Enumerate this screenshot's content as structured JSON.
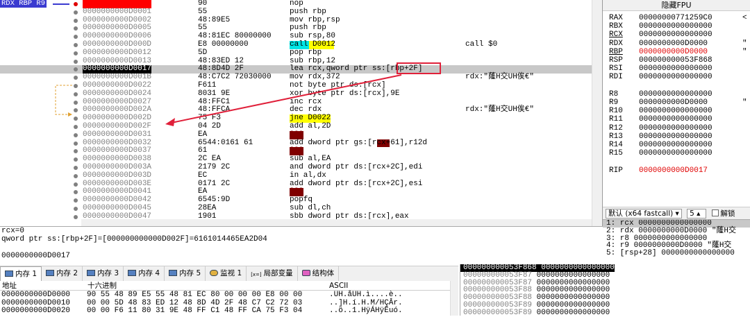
{
  "gutter_tags": [
    {
      "name": "tag-rdx-rbp-r9",
      "text": "RDX RBP R9"
    },
    {
      "name": "tag-rip",
      "text": "RIP"
    }
  ],
  "disasm": [
    {
      "addr": "0000000000D0000",
      "hex": "90",
      "ins": "nop",
      "cmt": "",
      "dot": "red",
      "addr_style": "hl"
    },
    {
      "addr": "0000000000D0001",
      "hex": "55",
      "ins": "push rbp",
      "cmt": ""
    },
    {
      "addr": "0000000000D0002",
      "hex": "48:89E5",
      "ins": "mov rbp,rsp",
      "cmt": ""
    },
    {
      "addr": "0000000000D0005",
      "hex": "55",
      "ins": "push rbp",
      "cmt": ""
    },
    {
      "addr": "0000000000D0006",
      "hex": "48:81EC 80000000",
      "ins": "sub rsp,80",
      "cmt": ""
    },
    {
      "addr": "0000000000D000D",
      "hex": "E8 00000000",
      "ins": "call D0012",
      "cmt": "call $0",
      "ins_style": "call"
    },
    {
      "addr": "0000000000D0012",
      "hex": "5D",
      "ins": "pop rbp",
      "cmt": ""
    },
    {
      "addr": "0000000000D0013",
      "hex": "48:83ED 12",
      "ins": "sub rbp,12",
      "cmt": ""
    },
    {
      "addr": "0000000000D0017",
      "hex": "48:8D4D 2F",
      "ins": "lea rcx,qword ptr ss:[rbp+2F]",
      "cmt": "",
      "addr_style": "rip",
      "sel": true
    },
    {
      "addr": "0000000000D001B",
      "hex": "48:C7C2 72030000",
      "ins": "mov rdx,372",
      "cmt": "rdx:\"蕯H交UH俟€\""
    },
    {
      "addr": "0000000000D0022",
      "hex": "F611",
      "ins": "not byte ptr ds:[rcx]",
      "cmt": ""
    },
    {
      "addr": "0000000000D0024",
      "hex": "8031 9E",
      "ins": "xor byte ptr ds:[rcx],9E",
      "cmt": ""
    },
    {
      "addr": "0000000000D0027",
      "hex": "48:FFC1",
      "ins": "inc rcx",
      "cmt": ""
    },
    {
      "addr": "0000000000D002A",
      "hex": "48:FFCA",
      "ins": "dec rdx",
      "cmt": "rdx:\"蕯H交UH俟€\""
    },
    {
      "addr": "0000000000D002D",
      "hex": "75 F3",
      "ins": "jne D0022",
      "cmt": "",
      "ins_style": "jne"
    },
    {
      "addr": "0000000000D002F",
      "hex": "04 2D",
      "ins": "add al,2D",
      "cmt": ""
    },
    {
      "addr": "0000000000D0031",
      "hex": "EA",
      "ins": "???",
      "cmt": "",
      "ins_style": "bad"
    },
    {
      "addr": "0000000000D0032",
      "hex": "6544:0161 61",
      "ins": "add dword ptr gs:[rcx+61],r12d",
      "cmt": "",
      "ins_style": "seg"
    },
    {
      "addr": "0000000000D0037",
      "hex": "61",
      "ins": "???",
      "cmt": "",
      "ins_style": "bad"
    },
    {
      "addr": "0000000000D0038",
      "hex": "2C EA",
      "ins": "sub al,EA",
      "cmt": ""
    },
    {
      "addr": "0000000000D003A",
      "hex": "2179 2C",
      "ins": "and dword ptr ds:[rcx+2C],edi",
      "cmt": ""
    },
    {
      "addr": "0000000000D003D",
      "hex": "EC",
      "ins": "in al,dx",
      "cmt": ""
    },
    {
      "addr": "0000000000D003E",
      "hex": "0171 2C",
      "ins": "add dword ptr ds:[rcx+2C],esi",
      "cmt": ""
    },
    {
      "addr": "0000000000D0041",
      "hex": "EA",
      "ins": "???",
      "cmt": "",
      "ins_style": "bad"
    },
    {
      "addr": "0000000000D0042",
      "hex": "6545:9D",
      "ins": "popfq",
      "cmt": ""
    },
    {
      "addr": "0000000000D0045",
      "hex": "28EA",
      "ins": "sub dl,ch",
      "cmt": ""
    },
    {
      "addr": "0000000000D0047",
      "hex": "1901",
      "ins": "sbb dword ptr ds:[rcx],eax",
      "cmt": ""
    }
  ],
  "fpu_header": "隐藏FPU",
  "registers": [
    {
      "n": "RAX",
      "v": "00000000771259C0",
      "extra": "<"
    },
    {
      "n": "RBX",
      "v": "0000000000000000",
      "extra": ""
    },
    {
      "n": "RCX",
      "v": "0000000000000000",
      "extra": ""
    },
    {
      "n": "RDX",
      "v": "0000000000D0000",
      "extra": "\""
    },
    {
      "n": "RBP",
      "v": "0000000000D0000",
      "extra": "\"",
      "changed": true
    },
    {
      "n": "RSP",
      "v": "000000000053F868",
      "extra": ""
    },
    {
      "n": "RSI",
      "v": "0000000000000000",
      "extra": ""
    },
    {
      "n": "RDI",
      "v": "0000000000000000",
      "extra": ""
    },
    {
      "n": "",
      "v": "",
      "extra": ""
    },
    {
      "n": "R8",
      "v": "0000000000000000",
      "extra": ""
    },
    {
      "n": "R9",
      "v": "0000000000D0000",
      "extra": "\""
    },
    {
      "n": "R10",
      "v": "0000000000000000",
      "extra": ""
    },
    {
      "n": "R11",
      "v": "0000000000000000",
      "extra": ""
    },
    {
      "n": "R12",
      "v": "0000000000000000",
      "extra": ""
    },
    {
      "n": "R13",
      "v": "0000000000000000",
      "extra": ""
    },
    {
      "n": "R14",
      "v": "0000000000000000",
      "extra": ""
    },
    {
      "n": "R15",
      "v": "0000000000000000",
      "extra": ""
    },
    {
      "n": "",
      "v": "",
      "extra": ""
    },
    {
      "n": "RIP",
      "v": "0000000000D0017",
      "extra": "",
      "changed": true
    }
  ],
  "callconv": {
    "select": "默认 (x64 fastcall)",
    "spin": "5",
    "unlock": "解锁"
  },
  "stack_args": [
    "1: rcx 0000000000000000",
    "2: rdx 0000000000D0000 \"蕯H交",
    "3: r8 0000000000000000",
    "4: r9 0000000000D0000 \"蕯H交",
    "5: [rsp+28] 0000000000000000"
  ],
  "info_lines": [
    "rcx=0",
    "qword ptr ss:[rbp+2F]=[000000000000D002F]=6161014465EA2D04",
    "",
    "0000000000D0017"
  ],
  "tabs": [
    {
      "label": "内存 1",
      "icon": "memory-icon",
      "active": true
    },
    {
      "label": "内存 2",
      "icon": "memory-icon"
    },
    {
      "label": "内存 3",
      "icon": "memory-icon"
    },
    {
      "label": "内存 4",
      "icon": "memory-icon"
    },
    {
      "label": "内存 5",
      "icon": "memory-icon"
    },
    {
      "label": "监视 1",
      "icon": "watch-icon"
    },
    {
      "label": "局部变量",
      "icon": "locals-icon",
      "prefix": "[x=]"
    },
    {
      "label": "结构体",
      "icon": "struct-icon"
    }
  ],
  "dump_header": {
    "addr": "地址",
    "hex": "十六进制",
    "ascii": "ASCII"
  },
  "dump_rows": [
    {
      "a": "0000000000D0000",
      "h": "90 55 48 89 E5 55 48 81 EC 80 00 00 00 E8 00 00",
      "c": ".UH.åUH.ì....è.."
    },
    {
      "a": "0000000000D0010",
      "h": "00 00 5D 48 83 ED 12 48 8D 4D 2F 48 C7 C2 72 03",
      "c": "..]H.í.H.M/HÇÂr."
    },
    {
      "a": "0000000000D0020",
      "h": "00 00 F6 11 80 31 9E 48 FF C1 48 FF CA 75 F3 04",
      "c": "..ö..1.HÿÁHÿÊuó."
    }
  ],
  "stack_rows": [
    {
      "a": "000000000053F868",
      "v": "0000000000000000"
    },
    {
      "a": "000000000053F87",
      "v": "0000000000000000"
    },
    {
      "a": "000000000053F87",
      "v": "0000000000000000"
    },
    {
      "a": "000000000053F88",
      "v": "0000000000000000"
    },
    {
      "a": "000000000053F88",
      "v": "0000000000000000"
    },
    {
      "a": "000000000053F89",
      "v": "0000000000000000"
    },
    {
      "a": "000000000053F89",
      "v": "0000000000000000"
    }
  ]
}
